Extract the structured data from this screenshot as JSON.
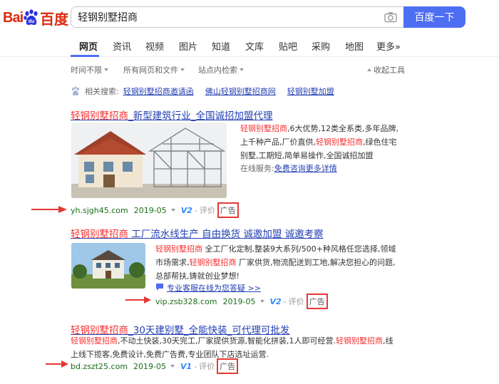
{
  "brand": {
    "logo_left": "Bai",
    "logo_paw": "du",
    "logo_right": "百度",
    "accent": "#4e6ef2",
    "red": "#de2910"
  },
  "search": {
    "query": "轻钢别墅招商",
    "button": "百度一下"
  },
  "tabs": [
    "网页",
    "资讯",
    "视频",
    "图片",
    "知道",
    "文库",
    "贴吧",
    "采购",
    "地图",
    "更多»"
  ],
  "filters": {
    "time": "时间不限",
    "type": "所有网页和文件",
    "site": "站点内检索",
    "collapse": "收起工具"
  },
  "related": {
    "label": "相关搜索:",
    "items": [
      "轻钢别墅招商邀请函",
      "佛山轻钢别墅招商网",
      "轻钢别墅加盟"
    ]
  },
  "results": [
    {
      "title_hl": "轻钢别墅招商",
      "title_rest": "_新型建筑行业_全国诚招加盟代理",
      "desc_lines": [
        [
          {
            "hl": "轻钢别墅招商"
          },
          {
            "t": ",6大优势,12类全系类,多年品牌,"
          }
        ],
        [
          {
            "t": "上千种产品,厂价直供,"
          },
          {
            "hl": "轻钢别墅招商"
          },
          {
            "t": ",绿色住宅"
          }
        ],
        [
          {
            "t": "别墅,工期短,简单易操作,全国诚招加盟"
          }
        ]
      ],
      "service_label": "在线服务:",
      "service_link": "免费咨询更多详情",
      "url": "yh.sjgh45.com",
      "date": "2019-05",
      "v": "V2",
      "comment": "评价",
      "ad": "广告"
    },
    {
      "title_hl": "轻钢别墅招商",
      "title_rest": " 工厂流水线生产 自由换货 诚邀加盟 诚邀考察",
      "desc_lines": [
        [
          {
            "hl": "轻钢别墅招商"
          },
          {
            "t": " 全工厂化定制,整装9大系列/500+种风格任您选择,领域"
          }
        ],
        [
          {
            "t": "市场需求,"
          },
          {
            "hl": "轻钢别墅招商"
          },
          {
            "t": " 厂家供货,物流配送到工地,解决您担心的问题,"
          }
        ],
        [
          {
            "t": "总部帮扶,铸就创业梦想!"
          }
        ]
      ],
      "service_link": "专业客服在线为您答疑 >>",
      "url": "vip.zsb328.com",
      "date": "2019-05",
      "v": "V2",
      "comment": "评价",
      "ad": "广告"
    },
    {
      "title_hl": "轻钢别墅招商",
      "title_rest": "_30天建别墅_全能快装_可代理可批发",
      "desc_lines": [
        [
          {
            "hl": "轻钢别墅招商"
          },
          {
            "t": ",不动土快装,30天完工,厂家提供货源,智能化拼装,1人即可经营."
          },
          {
            "hl": "轻钢别墅招商"
          },
          {
            "t": ",线"
          }
        ],
        [
          {
            "t": "上线下揽客,免费设计,免费广告费,专业团队下店选址运营."
          }
        ]
      ],
      "url": "bd.zszt25.com",
      "date": "2019-05",
      "v": "V1",
      "comment": "评价",
      "ad": "广告"
    }
  ]
}
